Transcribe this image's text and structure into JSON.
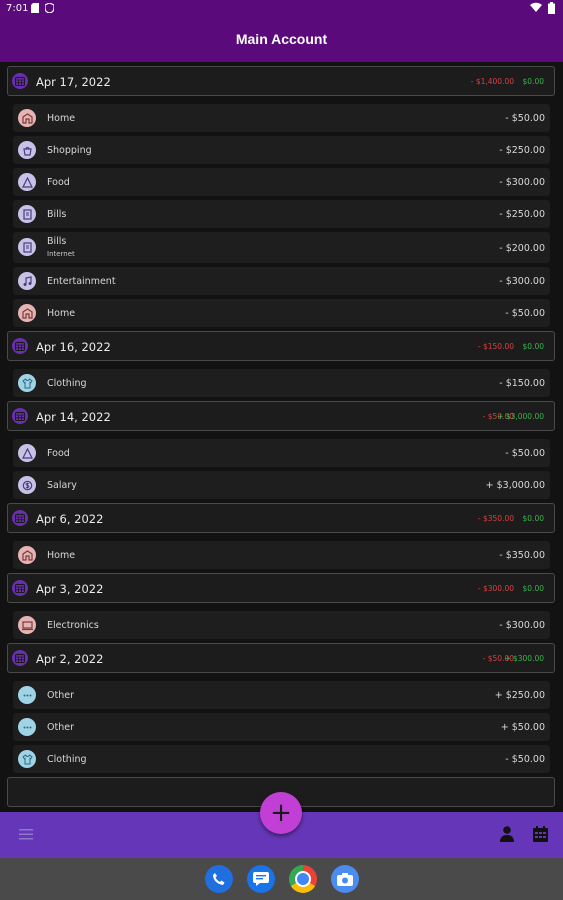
{
  "status_bar": {
    "time": "7:01"
  },
  "app_bar": {
    "title": "Main Account"
  },
  "colors": {
    "app_bar": "#5a0a7a",
    "bottom_bar": "#6636b8",
    "fab": "#c23fd6",
    "negative": "#d94141",
    "positive": "#39b54a"
  },
  "groups": [
    {
      "date": "Apr 17, 2022",
      "expense_total": "- $1,400.00",
      "income_total": "$0.00",
      "items": [
        {
          "category": "Home",
          "icon": "home-icon",
          "amount": "- $50.00"
        },
        {
          "category": "Shopping",
          "icon": "shopping-icon",
          "amount": "- $250.00"
        },
        {
          "category": "Food",
          "icon": "food-icon",
          "amount": "- $300.00"
        },
        {
          "category": "Bills",
          "icon": "bills-icon",
          "amount": "- $250.00"
        },
        {
          "category": "Bills",
          "note": "Internet",
          "icon": "bills-icon",
          "amount": "- $200.00"
        },
        {
          "category": "Entertainment",
          "icon": "music-icon",
          "amount": "- $300.00"
        },
        {
          "category": "Home",
          "icon": "home-icon",
          "amount": "- $50.00"
        }
      ]
    },
    {
      "date": "Apr 16, 2022",
      "expense_total": "- $150.00",
      "income_total": "$0.00",
      "items": [
        {
          "category": "Clothing",
          "icon": "clothing-icon",
          "amount": "- $150.00"
        }
      ]
    },
    {
      "date": "Apr 14, 2022",
      "expense_total": "- $50.00",
      "income_total": "+ $3,000.00",
      "items": [
        {
          "category": "Food",
          "icon": "food-icon",
          "amount": "- $50.00"
        },
        {
          "category": "Salary",
          "icon": "salary-icon",
          "amount": "+ $3,000.00"
        }
      ]
    },
    {
      "date": "Apr 6, 2022",
      "expense_total": "- $350.00",
      "income_total": "$0.00",
      "items": [
        {
          "category": "Home",
          "icon": "home-icon",
          "amount": "- $350.00"
        }
      ]
    },
    {
      "date": "Apr 3, 2022",
      "expense_total": "- $300.00",
      "income_total": "$0.00",
      "items": [
        {
          "category": "Electronics",
          "icon": "electronics-icon",
          "amount": "- $300.00"
        }
      ]
    },
    {
      "date": "Apr 2, 2022",
      "expense_total": "- $50.00",
      "income_total": "+ $300.00",
      "items": [
        {
          "category": "Other",
          "icon": "other-icon",
          "amount": "+ $250.00"
        },
        {
          "category": "Other",
          "icon": "other-icon",
          "amount": "+ $50.00"
        },
        {
          "category": "Clothing",
          "icon": "clothing-icon",
          "amount": "- $50.00"
        }
      ]
    }
  ],
  "fab": {
    "label": "+"
  },
  "dock_apps": [
    "phone-icon",
    "messages-icon",
    "chrome-icon",
    "camera-icon"
  ]
}
